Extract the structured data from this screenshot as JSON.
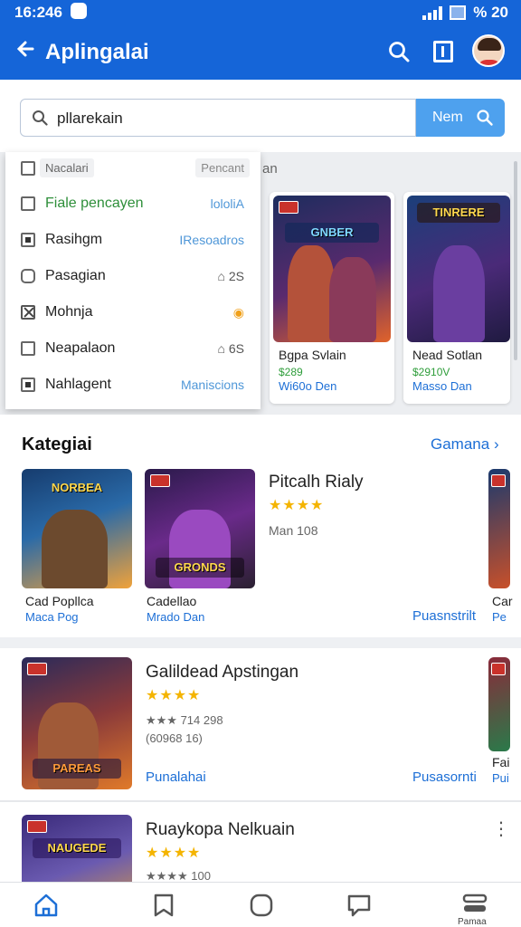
{
  "status": {
    "time": "16:246",
    "right_text": "% 20"
  },
  "appbar": {
    "title": "Aplingalai"
  },
  "search": {
    "value": "pllarekain",
    "button_label": "Nem"
  },
  "strip": {
    "label": "an"
  },
  "dropdown": {
    "header_left": "Nacalari",
    "header_right": "Pencant",
    "items": [
      {
        "label": "Fiale pencayen",
        "meta": "lololiA",
        "state": "unchecked"
      },
      {
        "label": "Rasihgm",
        "meta": "IResoadros",
        "state": "checked"
      },
      {
        "label": "Pasagian",
        "meta": "2S",
        "state": "outline"
      },
      {
        "label": "Mohnja",
        "meta": "",
        "state": "x"
      },
      {
        "label": "Neapalaon",
        "meta": "6S",
        "state": "unchecked"
      },
      {
        "label": "Nahlagent",
        "meta": "Maniscions",
        "state": "checked"
      }
    ]
  },
  "top_cards": [
    {
      "name": "Bgpa Svlain",
      "price": "$289",
      "sub": "Wi60o Den",
      "logo": "GNBER"
    },
    {
      "name": "Nead Sotlan",
      "price": "$2910V",
      "sub": "Masso Dan",
      "logo": "TINRERE"
    }
  ],
  "kategori": {
    "title": "Kategiai",
    "link": "Gamana",
    "tiles": [
      {
        "name": "Cad Popllca",
        "sub": "Maca Pog",
        "logo": "NORBEA"
      },
      {
        "name": "Cadellao",
        "sub": "Mrado Dan",
        "logo": "GRONDS"
      },
      {
        "name": "Car",
        "sub": "Pe",
        "logo": ""
      }
    ],
    "feature": {
      "title": "Pitcalh Rialy",
      "stars": "★★★★",
      "meta": "Man 108",
      "action": "Puasnstrilt"
    }
  },
  "list": [
    {
      "title": "Galildead Apstingan",
      "stars": "★★★★",
      "rating": "★★★ 714 298",
      "count": "(60968 16)",
      "link_left": "Punalahai",
      "link_right": "Pusasornti",
      "side_name": "Fai",
      "side_sub": "Pui",
      "logo": "PAREAS"
    },
    {
      "title": "Ruaykopa Nelkuain",
      "stars": "★★★★",
      "rating": "★★★★ 100",
      "logo": "NAUGEDE"
    }
  ],
  "bottomnav": {
    "last_label": "Pamaa"
  },
  "colors": {
    "primary": "#1565d8",
    "accent": "#4ea1ee",
    "link": "#1d6fd6",
    "star": "#f4b400"
  }
}
